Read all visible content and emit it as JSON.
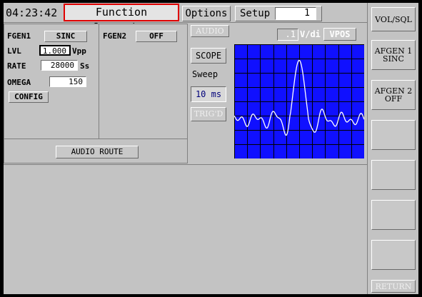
{
  "header": {
    "time": "04:23:42",
    "title": "Function Generator",
    "options_label": "Options",
    "setup_label": "Setup",
    "setup_value": "1"
  },
  "fgen1": {
    "name": "FGEN1",
    "wave": "SINC",
    "lvl_label": "LVL",
    "lvl_value": "1.000",
    "lvl_unit": "Vpp",
    "rate_label": "RATE",
    "rate_value": "28000",
    "rate_unit": "Ss",
    "omega_label": "OMEGA",
    "omega_value": "150",
    "config_label": "CONFIG"
  },
  "fgen2": {
    "name": "FGEN2",
    "state": "OFF"
  },
  "audio_route_label": "AUDIO ROUTE",
  "scope": {
    "audio_label": "AUDIO",
    "scale_value": ".1",
    "scale_unit": "V/di",
    "vpos_label": "VPOS",
    "scope_label": "SCOPE",
    "sweep_label": "Sweep",
    "sweep_value": "10 ms",
    "trig_label": "TRIG'D",
    "colors": {
      "background": "#1010ff",
      "grid": "#000000",
      "trace": "#ffffff"
    }
  },
  "softkeys": [
    {
      "line1": "VOL/SQL",
      "line2": ""
    },
    {
      "line1": "AFGEN 1",
      "line2": "SINC"
    },
    {
      "line1": "AFGEN 2",
      "line2": "OFF"
    },
    {
      "line1": "",
      "line2": ""
    },
    {
      "line1": "",
      "line2": ""
    },
    {
      "line1": "",
      "line2": ""
    },
    {
      "line1": "",
      "line2": ""
    },
    {
      "line1": "RETURN",
      "line2": ""
    }
  ]
}
